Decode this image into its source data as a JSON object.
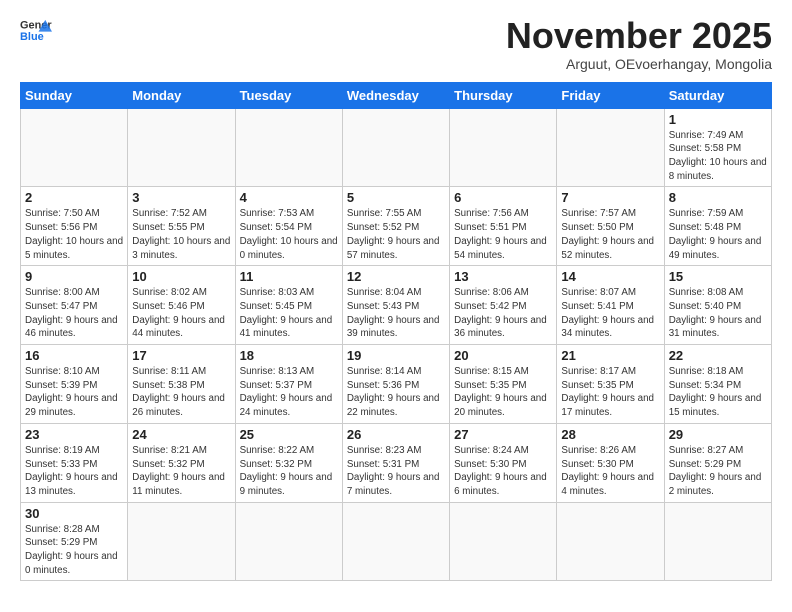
{
  "header": {
    "logo": {
      "text_general": "General",
      "text_blue": "Blue"
    },
    "title": "November 2025",
    "subtitle": "Arguut, OEvoerhangay, Mongolia"
  },
  "days_of_week": [
    "Sunday",
    "Monday",
    "Tuesday",
    "Wednesday",
    "Thursday",
    "Friday",
    "Saturday"
  ],
  "weeks": [
    [
      {
        "day": "",
        "info": ""
      },
      {
        "day": "",
        "info": ""
      },
      {
        "day": "",
        "info": ""
      },
      {
        "day": "",
        "info": ""
      },
      {
        "day": "",
        "info": ""
      },
      {
        "day": "",
        "info": ""
      },
      {
        "day": "1",
        "info": "Sunrise: 7:49 AM\nSunset: 5:58 PM\nDaylight: 10 hours and 8 minutes."
      }
    ],
    [
      {
        "day": "2",
        "info": "Sunrise: 7:50 AM\nSunset: 5:56 PM\nDaylight: 10 hours and 5 minutes."
      },
      {
        "day": "3",
        "info": "Sunrise: 7:52 AM\nSunset: 5:55 PM\nDaylight: 10 hours and 3 minutes."
      },
      {
        "day": "4",
        "info": "Sunrise: 7:53 AM\nSunset: 5:54 PM\nDaylight: 10 hours and 0 minutes."
      },
      {
        "day": "5",
        "info": "Sunrise: 7:55 AM\nSunset: 5:52 PM\nDaylight: 9 hours and 57 minutes."
      },
      {
        "day": "6",
        "info": "Sunrise: 7:56 AM\nSunset: 5:51 PM\nDaylight: 9 hours and 54 minutes."
      },
      {
        "day": "7",
        "info": "Sunrise: 7:57 AM\nSunset: 5:50 PM\nDaylight: 9 hours and 52 minutes."
      },
      {
        "day": "8",
        "info": "Sunrise: 7:59 AM\nSunset: 5:48 PM\nDaylight: 9 hours and 49 minutes."
      }
    ],
    [
      {
        "day": "9",
        "info": "Sunrise: 8:00 AM\nSunset: 5:47 PM\nDaylight: 9 hours and 46 minutes."
      },
      {
        "day": "10",
        "info": "Sunrise: 8:02 AM\nSunset: 5:46 PM\nDaylight: 9 hours and 44 minutes."
      },
      {
        "day": "11",
        "info": "Sunrise: 8:03 AM\nSunset: 5:45 PM\nDaylight: 9 hours and 41 minutes."
      },
      {
        "day": "12",
        "info": "Sunrise: 8:04 AM\nSunset: 5:43 PM\nDaylight: 9 hours and 39 minutes."
      },
      {
        "day": "13",
        "info": "Sunrise: 8:06 AM\nSunset: 5:42 PM\nDaylight: 9 hours and 36 minutes."
      },
      {
        "day": "14",
        "info": "Sunrise: 8:07 AM\nSunset: 5:41 PM\nDaylight: 9 hours and 34 minutes."
      },
      {
        "day": "15",
        "info": "Sunrise: 8:08 AM\nSunset: 5:40 PM\nDaylight: 9 hours and 31 minutes."
      }
    ],
    [
      {
        "day": "16",
        "info": "Sunrise: 8:10 AM\nSunset: 5:39 PM\nDaylight: 9 hours and 29 minutes."
      },
      {
        "day": "17",
        "info": "Sunrise: 8:11 AM\nSunset: 5:38 PM\nDaylight: 9 hours and 26 minutes."
      },
      {
        "day": "18",
        "info": "Sunrise: 8:13 AM\nSunset: 5:37 PM\nDaylight: 9 hours and 24 minutes."
      },
      {
        "day": "19",
        "info": "Sunrise: 8:14 AM\nSunset: 5:36 PM\nDaylight: 9 hours and 22 minutes."
      },
      {
        "day": "20",
        "info": "Sunrise: 8:15 AM\nSunset: 5:35 PM\nDaylight: 9 hours and 20 minutes."
      },
      {
        "day": "21",
        "info": "Sunrise: 8:17 AM\nSunset: 5:35 PM\nDaylight: 9 hours and 17 minutes."
      },
      {
        "day": "22",
        "info": "Sunrise: 8:18 AM\nSunset: 5:34 PM\nDaylight: 9 hours and 15 minutes."
      }
    ],
    [
      {
        "day": "23",
        "info": "Sunrise: 8:19 AM\nSunset: 5:33 PM\nDaylight: 9 hours and 13 minutes."
      },
      {
        "day": "24",
        "info": "Sunrise: 8:21 AM\nSunset: 5:32 PM\nDaylight: 9 hours and 11 minutes."
      },
      {
        "day": "25",
        "info": "Sunrise: 8:22 AM\nSunset: 5:32 PM\nDaylight: 9 hours and 9 minutes."
      },
      {
        "day": "26",
        "info": "Sunrise: 8:23 AM\nSunset: 5:31 PM\nDaylight: 9 hours and 7 minutes."
      },
      {
        "day": "27",
        "info": "Sunrise: 8:24 AM\nSunset: 5:30 PM\nDaylight: 9 hours and 6 minutes."
      },
      {
        "day": "28",
        "info": "Sunrise: 8:26 AM\nSunset: 5:30 PM\nDaylight: 9 hours and 4 minutes."
      },
      {
        "day": "29",
        "info": "Sunrise: 8:27 AM\nSunset: 5:29 PM\nDaylight: 9 hours and 2 minutes."
      }
    ],
    [
      {
        "day": "30",
        "info": "Sunrise: 8:28 AM\nSunset: 5:29 PM\nDaylight: 9 hours and 0 minutes."
      },
      {
        "day": "",
        "info": ""
      },
      {
        "day": "",
        "info": ""
      },
      {
        "day": "",
        "info": ""
      },
      {
        "day": "",
        "info": ""
      },
      {
        "day": "",
        "info": ""
      },
      {
        "day": "",
        "info": ""
      }
    ]
  ]
}
